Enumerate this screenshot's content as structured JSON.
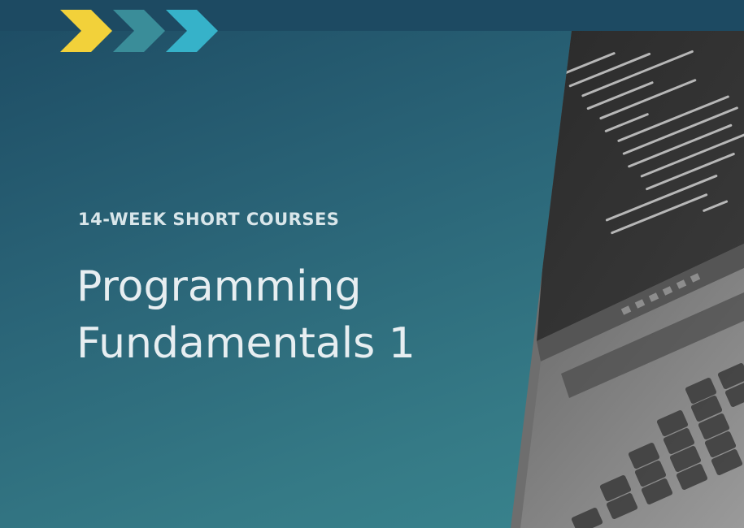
{
  "colors": {
    "background_dark": "#1d4a62",
    "background_teal": "#3a8790",
    "chevron_yellow": "#f2d13a",
    "chevron_teal": "#3a8d99",
    "chevron_cyan": "#36b2c9",
    "text_light": "#e7eef1"
  },
  "decor": {
    "chevrons_icon": "triple-chevron-right-icon",
    "photo": "laptop-code-photo-grayscale"
  },
  "course": {
    "subtitle": "14-WEEK SHORT COURSES",
    "title_line1": "Programming",
    "title_line2": "Fundamentals 1"
  }
}
